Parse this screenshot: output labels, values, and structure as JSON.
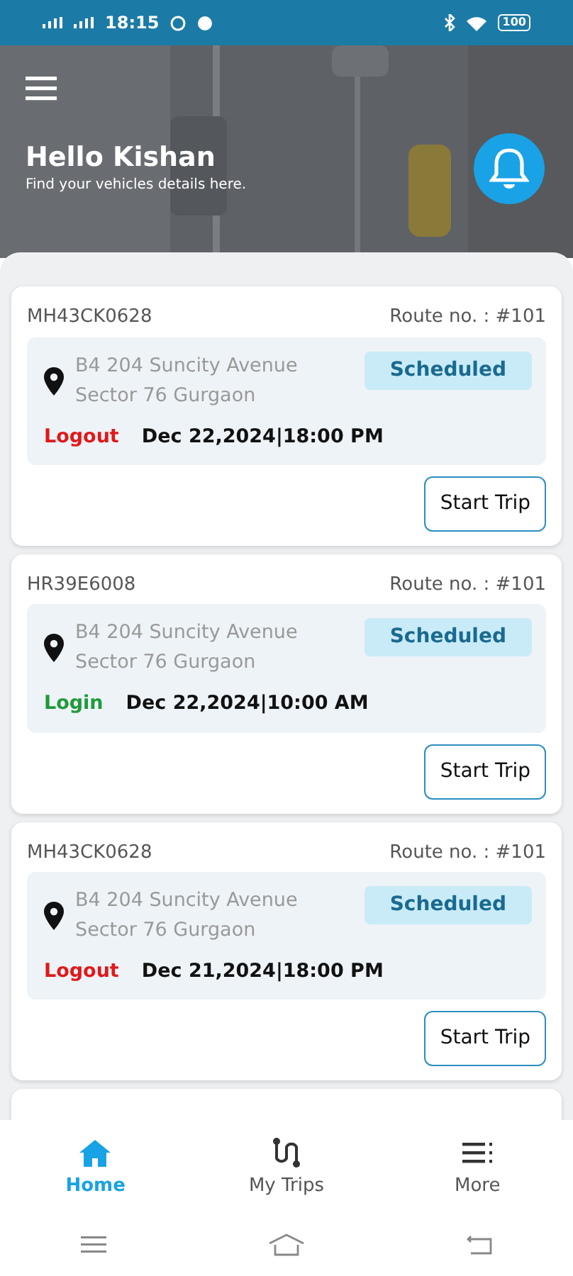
{
  "status_bar": {
    "time": "18:15",
    "battery": "100"
  },
  "header": {
    "title": "Hello Kishan",
    "subtitle": "Find your vehicles details here."
  },
  "trips": [
    {
      "vehicle": "MH43CK0628",
      "route": "Route no. : #101",
      "address_line_1": "B4 204 Suncity Avenue",
      "address_line_2": "Sector 76 Gurgaon",
      "status": "Scheduled",
      "kind": "logout",
      "type_label": "Logout",
      "datetime": "Dec 22,2024|18:00 PM",
      "action": "Start Trip"
    },
    {
      "vehicle": "HR39E6008",
      "route": "Route no. : #101",
      "address_line_1": "B4 204 Suncity Avenue",
      "address_line_2": "Sector 76 Gurgaon",
      "status": "Scheduled",
      "kind": "login",
      "type_label": "Login",
      "datetime": "Dec 22,2024|10:00 AM",
      "action": "Start Trip"
    },
    {
      "vehicle": "MH43CK0628",
      "route": "Route no. : #101",
      "address_line_1": "B4 204 Suncity Avenue",
      "address_line_2": "Sector 76 Gurgaon",
      "status": "Scheduled",
      "kind": "logout",
      "type_label": "Logout",
      "datetime": "Dec 21,2024|18:00 PM",
      "action": "Start Trip"
    }
  ],
  "bottom_nav": [
    {
      "label": "Home",
      "kind": "home",
      "selected": true
    },
    {
      "label": "My Trips",
      "kind": "trips",
      "selected": false
    },
    {
      "label": "More",
      "kind": "more",
      "selected": false
    }
  ]
}
